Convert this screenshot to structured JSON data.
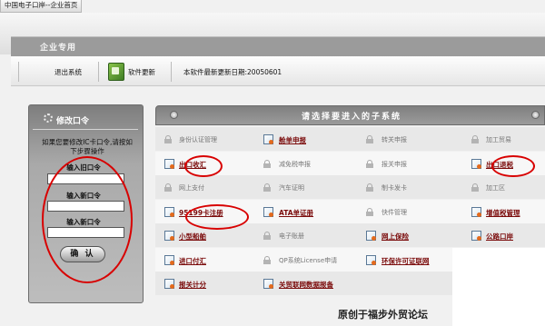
{
  "window": {
    "tab_title": "中国电子口岸--企业首页"
  },
  "banner": {
    "title": "企业专用"
  },
  "toolbar": {
    "exit_label": "退出系统",
    "update_label": "软件更新",
    "version_label": "本软件最新更新日期:20050601"
  },
  "password_panel": {
    "title": "修改口令",
    "description": "如果您要修改IC卡口令,请按如下步骤操作",
    "old_password_label": "输入旧口令",
    "new_password_label": "输入新口令",
    "confirm_password_label": "输入新口令",
    "confirm_button": "确 认"
  },
  "subsystems": {
    "title": "请选择要进入的子系统",
    "rows": [
      [
        "身份认证管理",
        "舱单申报",
        "转关申报",
        "加工贸易"
      ],
      [
        "出口收汇",
        "减免税申报",
        "报关申报",
        "出口退税"
      ],
      [
        "网上支付",
        "汽车证明",
        "制卡发卡",
        "加工区"
      ],
      [
        "95199卡注册",
        "ATA单证册",
        "快件管理",
        "增值税管理"
      ],
      [
        "小型船舶",
        "电子账册",
        "网上保险",
        "公路口岸"
      ],
      [
        "进口付汇",
        "QP系统License申请",
        "环保许可证联网",
        ""
      ],
      [
        "报关计分",
        "关贸联网数据报备",
        "",
        ""
      ]
    ],
    "active": [
      [
        false,
        true,
        false,
        false
      ],
      [
        true,
        false,
        false,
        true
      ],
      [
        false,
        false,
        false,
        false
      ],
      [
        true,
        true,
        false,
        true
      ],
      [
        true,
        false,
        true,
        true
      ],
      [
        true,
        false,
        true,
        false
      ],
      [
        true,
        true,
        false,
        false
      ]
    ]
  },
  "watermark": "原创于福步外贸论坛"
}
